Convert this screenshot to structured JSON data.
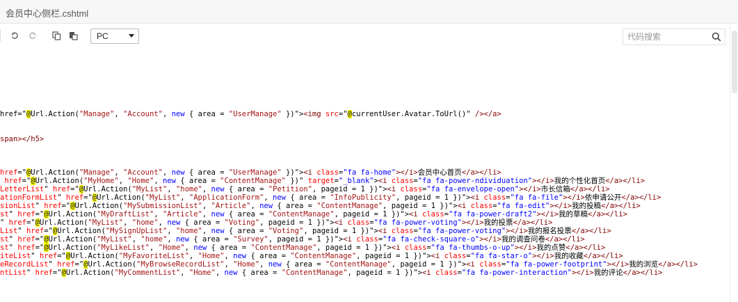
{
  "window": {
    "title": "会员中心侧栏.cshtml"
  },
  "toolbar": {
    "undo_icon": "undo-icon",
    "redo_icon": "redo-icon",
    "copy_icon": "copy-icon",
    "paste_icon": "paste-icon",
    "device_select": {
      "value": "PC"
    },
    "search": {
      "placeholder": "代码搜索",
      "icon": "search-icon"
    }
  },
  "code_lines": [
    {
      "html": "href=\"<span class='at'>@</span><span class='m'>Url.Action(</span><span class='str'>\"Manage\"</span><span class='m'>, </span><span class='str'>\"Account\"</span><span class='m'>, </span><span class='k'>new</span><span class='m'> { area = </span><span class='str'>\"UserManage\"</span><span class='m'> })</span>\"&gt;<span class='t'>&lt;img</span> <span class='a'>src</span>=\"<span class='at'>@</span><span class='m'>currentUser.Avatar.ToUrl()</span>\" <span class='t'>/&gt;&lt;/a&gt;</span>"
    },
    {
      "html": "<span class='t'>span&gt;&lt;/h5&gt;</span>"
    },
    {
      "html": "<span class='a'>href</span>=\"<span class='at'>@</span><span class='m'>Url.Action(</span><span class='str'>\"Manage\"</span><span class='m'>, </span><span class='str'>\"Account\"</span><span class='m'>, </span><span class='k'>new</span><span class='m'> { area = </span><span class='str'>\"UserManage\"</span><span class='m'> })</span>\"&gt;<span class='t'>&lt;i</span> <span class='a'>class</span>=<span class='s'>\"fa fa-home\"</span><span class='t'>&gt;&lt;/i&gt;</span><span class='txt'>会员中心首页</span><span class='t'>&lt;/a&gt;&lt;/li&gt;</span>"
    },
    {
      "html": " <span class='a'>href</span>=\"<span class='at'>@</span><span class='m'>Url.Action(</span><span class='str'>\"MyHome\"</span><span class='m'>, </span><span class='str'>\"Home\"</span><span class='m'>, </span><span class='k'>new</span><span class='m'> { area = </span><span class='str'>\"ContentManage\"</span><span class='m'> })</span>\" <span class='a'>target</span>=<span class='s'>\"_blank\"</span>&gt;<span class='t'>&lt;i</span> <span class='a'>class</span>=<span class='s'>\"fa fa-power-ndividuation\"</span><span class='t'>&gt;&lt;/i&gt;</span><span class='txt'>我的个性化首页</span><span class='t'>&lt;/a&gt;&lt;/li&gt;</span>"
    },
    {
      "html": "<span class='a'>LetterList</span>\" <span class='a'>href</span>=\"<span class='at'>@</span><span class='m'>Url.Action(</span><span class='str'>\"MyList\"</span><span class='m'>, </span><span class='str'>\"home\"</span><span class='m'>, </span><span class='k'>new</span><span class='m'> { area = </span><span class='str'>\"Petition\"</span><span class='m'>, pageid = 1 })</span>\"&gt;<span class='t'>&lt;i</span> <span class='a'>class</span>=<span class='s'>\"fa fa-envelope-open\"</span><span class='t'>&gt;&lt;/i&gt;</span><span class='txt'>市长信箱</span><span class='t'>&lt;/a&gt;&lt;/li&gt;</span>"
    },
    {
      "html": "<span class='a'>ationFormList</span>\" <span class='a'>href</span>=\"<span class='at'>@</span><span class='m'>Url.Action(</span><span class='str'>\"MyList\"</span><span class='m'>, </span><span class='str'>\"ApplicationForm\"</span><span class='m'>, </span><span class='k'>new</span><span class='m'> { area = </span><span class='str'>\"InfoPublicity\"</span><span class='m'>, pageid = 1 })</span>\"&gt;<span class='t'>&lt;i</span> <span class='a'>class</span>=<span class='s'>\"fa fa-file\"</span><span class='t'>&gt;&lt;/i&gt;</span><span class='txt'>依申请公开</span><span class='t'>&lt;/a&gt;&lt;/li&gt;</span>"
    },
    {
      "html": "<span class='a'>sionList</span>\" <span class='a'>href</span>=\"<span class='at'>@</span><span class='m'>Url.Action(</span><span class='str'>\"MySubmissionList\"</span><span class='m'>, </span><span class='str'>\"Article\"</span><span class='m'>, </span><span class='k'>new</span><span class='m'> { area = </span><span class='str'>\"ContentManage\"</span><span class='m'>, pageid = 1 })</span>\"&gt;<span class='t'>&lt;i</span> <span class='a'>class</span>=<span class='s'>\"fa fa-edit\"</span><span class='t'>&gt;&lt;/i&gt;</span><span class='txt'>我的投稿</span><span class='t'>&lt;/a&gt;&lt;/li&gt;</span>"
    },
    {
      "html": "<span class='a'>st</span>\" <span class='a'>href</span>=\"<span class='at'>@</span><span class='m'>Url.Action(</span><span class='str'>\"MyDraftList\"</span><span class='m'>, </span><span class='str'>\"Article\"</span><span class='m'>, </span><span class='k'>new</span><span class='m'> { area = </span><span class='str'>\"ContentManage\"</span><span class='m'>, pageid = 1 })</span>\"&gt;<span class='t'>&lt;i</span> <span class='a'>class</span>=<span class='s'>\"fa fa-power-draft2\"</span><span class='t'>&gt;&lt;/i&gt;</span><span class='txt'>我的草稿</span><span class='t'>&lt;/a&gt;&lt;/li&gt;</span>"
    },
    {
      "html": "\" <span class='a'>href</span>=\"<span class='at'>@</span><span class='m'>Url.Action(</span><span class='str'>\"MyList\"</span><span class='m'>, </span><span class='str'>\"home\"</span><span class='m'>, </span><span class='k'>new</span><span class='m'> { area = </span><span class='str'>\"Voting\"</span><span class='m'>, pageid = 1 })</span>\"&gt;<span class='t'>&lt;i</span> <span class='a'>class</span>=<span class='s'>\"fa fa-power-voting\"</span><span class='t'>&gt;&lt;/i&gt;</span><span class='txt'>我的投票</span><span class='t'>&lt;/a&gt;&lt;/li&gt;</span>"
    },
    {
      "html": "<span class='a'>List</span>\" <span class='a'>href</span>=\"<span class='at'>@</span><span class='m'>Url.Action(</span><span class='str'>\"MySignUpList\"</span><span class='m'>, </span><span class='str'>\"home\"</span><span class='m'>, </span><span class='k'>new</span><span class='m'> { area = </span><span class='str'>\"Voting\"</span><span class='m'>, pageid = 1 })</span>\"&gt;<span class='t'>&lt;i</span> <span class='a'>class</span>=<span class='s'>\"fa fa-power-voting\"</span><span class='t'>&gt;&lt;/i&gt;</span><span class='txt'>我的报名投票</span><span class='t'>&lt;/a&gt;&lt;/li&gt;</span>"
    },
    {
      "html": "<span class='a'>st</span>\" <span class='a'>href</span>=\"<span class='at'>@</span><span class='m'>Url.Action(</span><span class='str'>\"MyList\"</span><span class='m'>, </span><span class='str'>\"home\"</span><span class='m'>, </span><span class='k'>new</span><span class='m'> { area = </span><span class='str'>\"Survey\"</span><span class='m'>, pageid = 1 })</span>\"&gt;<span class='t'>&lt;i</span> <span class='a'>class</span>=<span class='s'>\"fa fa-check-square-o\"</span><span class='t'>&gt;&lt;/i&gt;</span><span class='txt'>我的调查问卷</span><span class='t'>&lt;/a&gt;&lt;/li&gt;</span>"
    },
    {
      "html": "<span class='a'>st</span>\" <span class='a'>href</span>=\"<span class='at'>@</span><span class='m'>Url.Action(</span><span class='str'>\"MyLikeList\"</span><span class='m'>, </span><span class='str'>\"Home\"</span><span class='m'>, </span><span class='k'>new</span><span class='m'> { area = </span><span class='str'>\"ContentManage\"</span><span class='m'>, pageid = 1 })</span>\"&gt;<span class='t'>&lt;i</span> <span class='a'>class</span>=<span class='s'>\"fa fa-thumbs-o-up\"</span><span class='t'>&gt;&lt;/i&gt;</span><span class='txt'>我的点赞</span><span class='t'>&lt;/a&gt;&lt;/li&gt;</span>"
    },
    {
      "html": "<span class='a'>iteList</span>\" <span class='a'>href</span>=\"<span class='at'>@</span><span class='m'>Url.Action(</span><span class='str'>\"MyFavoriteList\"</span><span class='m'>, </span><span class='str'>\"Home\"</span><span class='m'>, </span><span class='k'>new</span><span class='m'> { area = </span><span class='str'>\"ContentManage\"</span><span class='m'>, pageid = 1 })</span>\"&gt;<span class='t'>&lt;i</span> <span class='a'>class</span>=<span class='s'>\"fa fa-star-o\"</span><span class='t'>&gt;&lt;/i&gt;</span><span class='txt'>我的收藏</span><span class='t'>&lt;/a&gt;&lt;/li&gt;</span>"
    },
    {
      "html": "<span class='a'>eRecordList</span>\" <span class='a'>href</span>=\"<span class='at'>@</span><span class='m'>Url.Action(</span><span class='str'>\"MyBrowseRecordList\"</span><span class='m'>, </span><span class='str'>\"Home\"</span><span class='m'>, </span><span class='k'>new</span><span class='m'> { area = </span><span class='str'>\"ContentManage\"</span><span class='m'>, pageid = 1 })</span>\"&gt;<span class='t'>&lt;i</span> <span class='a'>class</span>=<span class='s'>\"fa fa-power-footprint\"</span><span class='t'>&gt;&lt;/i&gt;</span><span class='txt'>我的浏览</span><span class='t'>&lt;/a&gt;&lt;/li&gt;</span>"
    },
    {
      "html": "<span class='a'>ntList</span>\" <span class='a'>href</span>=\"<span class='at'>@</span><span class='m'>Url.Action(</span><span class='str'>\"MyCommentList\"</span><span class='m'>, </span><span class='str'>\"Home\"</span><span class='m'>, </span><span class='k'>new</span><span class='m'> { area = </span><span class='str'>\"ContentManage\"</span><span class='m'>, pageid = 1 })</span>\"&gt;<span class='t'>&lt;i</span> <span class='a'>class</span>=<span class='s'>\"fa fa-power-interaction\"</span><span class='t'>&gt;&lt;/i&gt;</span><span class='txt'>我的评论</span><span class='t'>&lt;/a&gt;&lt;/li&gt;</span>"
    }
  ]
}
